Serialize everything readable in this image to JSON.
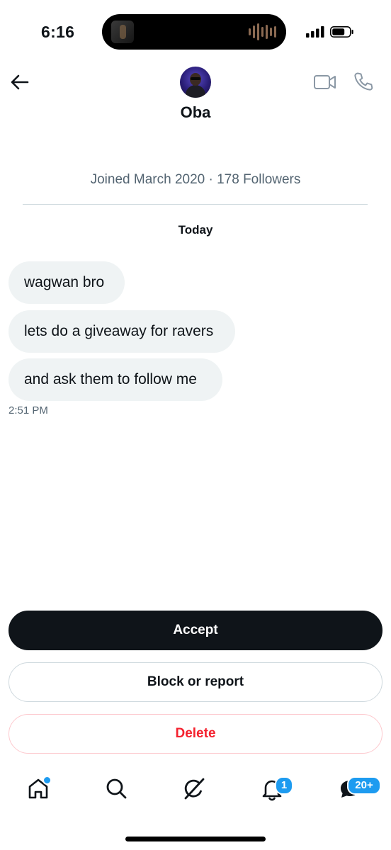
{
  "status_bar": {
    "time": "6:16"
  },
  "header": {
    "title": "Oba"
  },
  "profile_meta": "Joined March 2020 · 178 Followers",
  "day_separator": "Today",
  "messages": [
    {
      "text": "wagwan bro"
    },
    {
      "text": "lets do a giveaway for ravers"
    },
    {
      "text": "and ask them to follow me"
    }
  ],
  "message_time": "2:51 PM",
  "actions": {
    "accept": "Accept",
    "block_report": "Block or report",
    "delete": "Delete"
  },
  "tab_bar": {
    "notifications_badge": "1",
    "messages_badge": "20+"
  },
  "colors": {
    "accent": "#1d9bf0",
    "danger": "#f4212e",
    "bubble": "#eff3f4",
    "primary_button": "#0f1419"
  },
  "icons": [
    "back-arrow-icon",
    "video-call-icon",
    "phone-call-icon",
    "home-icon",
    "search-icon",
    "grok-icon",
    "bell-icon",
    "messages-icon"
  ]
}
